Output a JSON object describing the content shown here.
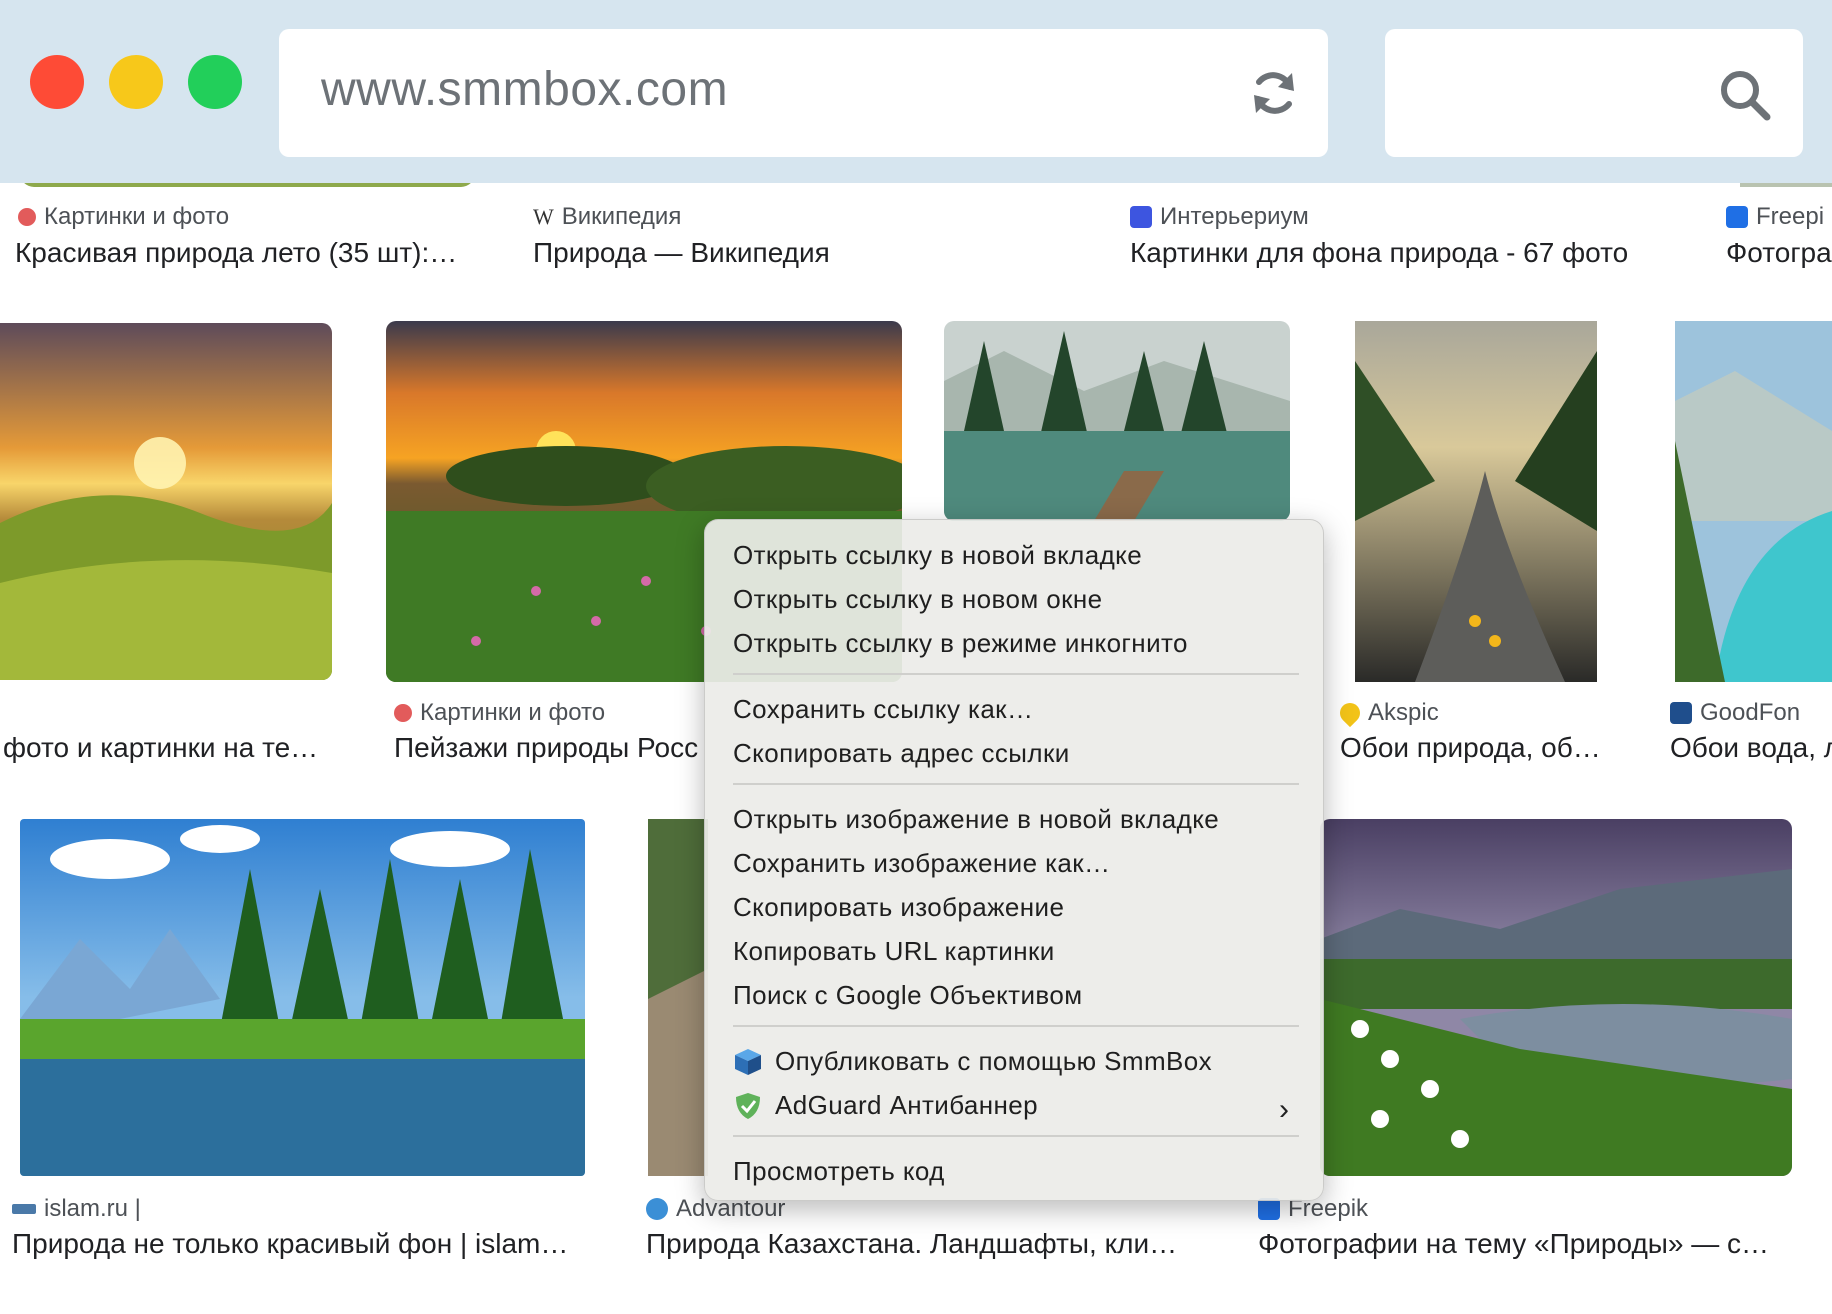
{
  "browser": {
    "url": "www.smmbox.com",
    "controls": {
      "close_color": "#fe4b36",
      "minimize_color": "#f7c81a",
      "maximize_color": "#22cf5a"
    }
  },
  "results": {
    "row1": [
      {
        "source": "Картинки и фото",
        "title": "Красивая природа лето (35 шт):…"
      },
      {
        "source": "Википедия",
        "title": "Природа — Википедия"
      },
      {
        "source": "Интерьериум",
        "title": "Картинки для фона природа - 67 фото"
      },
      {
        "source": "Freepi",
        "title": "Фотогра"
      }
    ],
    "row2": [
      {
        "source": "",
        "title": "фото и картинки на те…"
      },
      {
        "source": "Картинки и фото",
        "title": "Пейзажи природы Росс"
      },
      {
        "source": "Akspic",
        "title": "Обои природа, об…"
      },
      {
        "source": "GoodFon",
        "title": "Обои вода, л"
      }
    ],
    "row3": [
      {
        "source": "islam.ru |",
        "title": "Природа не только красивый фон | islam…"
      },
      {
        "source": "Advantour",
        "title": "Природа Казахстана. Ландшафты, кли…"
      },
      {
        "source": "Freepik",
        "title": "Фотографии на тему «Природы» — с…"
      }
    ]
  },
  "context_menu": {
    "items": [
      "Открыть ссылку в новой вкладке",
      "Открыть ссылку в новом окне",
      "Открыть ссылку в режиме инкогнито",
      "Сохранить ссылку как…",
      "Скопировать адрес ссылки",
      "Открыть изображение в новой вкладке",
      "Сохранить изображение как…",
      "Скопировать изображение",
      "Копировать URL картинки",
      "Поиск с Google Объективом",
      "Опубликовать с помощью SmmBox",
      "AdGuard Антибаннер",
      "Просмотреть код"
    ],
    "submenu_arrow": "›"
  },
  "icons": [
    "reload-icon",
    "search-icon",
    "smmbox-icon",
    "adguard-icon",
    "chevron-right-icon"
  ]
}
